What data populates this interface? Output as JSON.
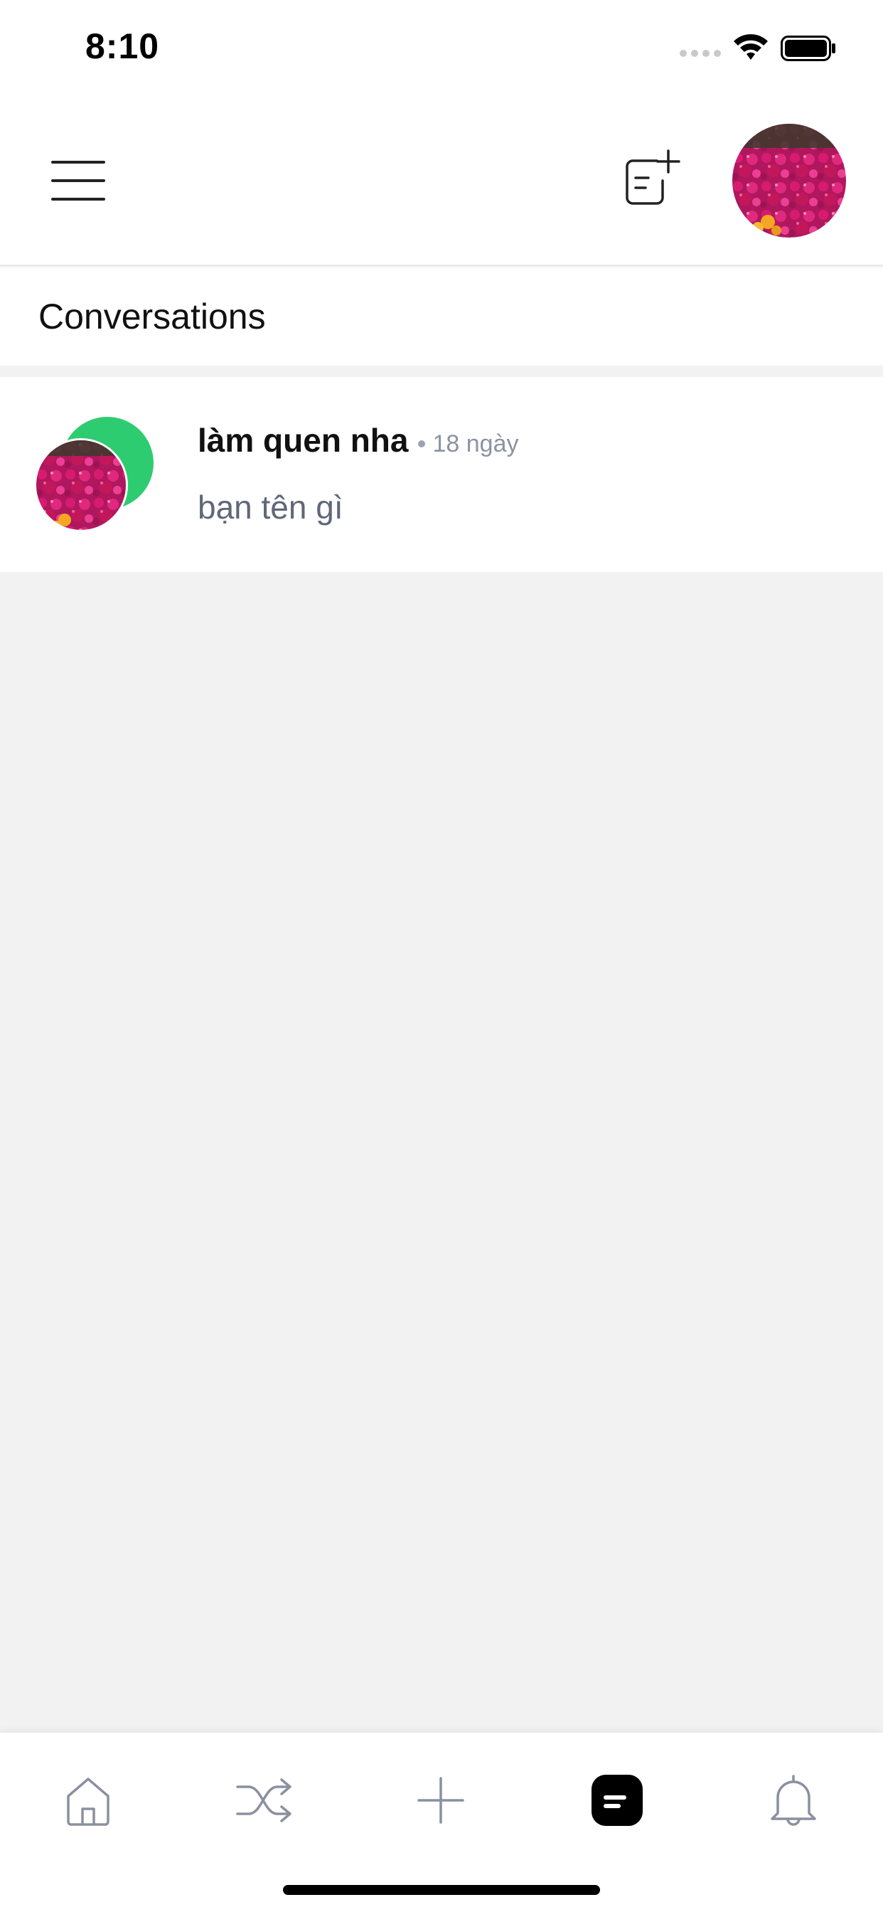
{
  "status_bar": {
    "time": "8:10",
    "icons": [
      "signal-dots-icon",
      "wifi-icon",
      "battery-icon"
    ]
  },
  "header": {
    "menu_icon": "hamburger-menu-icon",
    "compose_icon": "new-conversation-icon",
    "profile_avatar": "flower-avatar-image"
  },
  "section": {
    "title": "Conversations"
  },
  "conversations": [
    {
      "title": "làm quen nha",
      "time": "18 ngày",
      "preview": "bạn tên gì",
      "avatar_back_color": "#2ecc71",
      "avatar_front": "flower-avatar-image"
    }
  ],
  "tab_bar": {
    "tabs": [
      {
        "icon": "home-icon",
        "active": false
      },
      {
        "icon": "shuffle-icon",
        "active": false
      },
      {
        "icon": "plus-icon",
        "active": false
      },
      {
        "icon": "chat-icon",
        "active": true
      },
      {
        "icon": "bell-icon",
        "active": false
      }
    ]
  },
  "colors": {
    "background": "#f2f2f2",
    "surface": "#ffffff",
    "accent_green": "#2ecc71",
    "muted_text": "#8b93a3",
    "icon_gray": "#8a90a0"
  }
}
